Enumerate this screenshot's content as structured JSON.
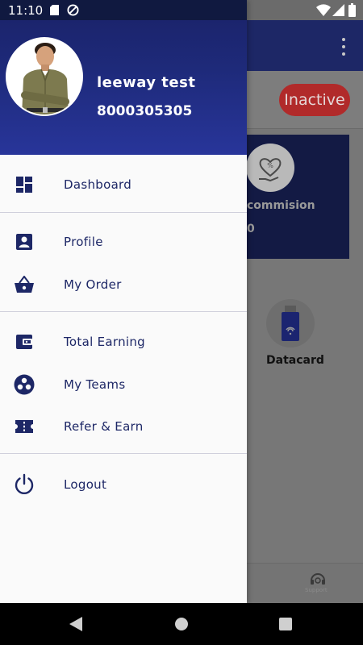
{
  "status_bar": {
    "time": "11:10",
    "icons": [
      "sd-card-icon",
      "do-not-disturb-icon",
      "wifi-icon",
      "signal-icon",
      "battery-icon"
    ]
  },
  "drawer": {
    "user": {
      "name": "leeway test",
      "phone": "8000305305",
      "avatar": "avatar-photo"
    },
    "sections": [
      [
        {
          "label": "Dashboard",
          "icon": "dashboard-icon"
        }
      ],
      [
        {
          "label": "Profile",
          "icon": "profile-icon"
        },
        {
          "label": "My Order",
          "icon": "basket-icon"
        }
      ],
      [
        {
          "label": "Total Earning",
          "icon": "wallet-icon"
        },
        {
          "label": "My Teams",
          "icon": "teams-icon"
        },
        {
          "label": "Refer & Earn",
          "icon": "ticket-icon"
        }
      ],
      [
        {
          "label": "Logout",
          "icon": "power-icon"
        }
      ]
    ]
  },
  "background_app": {
    "status_badge": "Inactive",
    "card_label": "commision",
    "card_value": "0",
    "tile_label": "Datacard",
    "bottom_nav_label": "Support"
  },
  "colors": {
    "primary": "#1d2766",
    "header_gradient_top": "#1a2268",
    "header_gradient_bottom": "#28359a",
    "inactive_badge": "#b12a2a",
    "drawer_bg": "#fafafa",
    "divider": "#d0d0dc"
  }
}
